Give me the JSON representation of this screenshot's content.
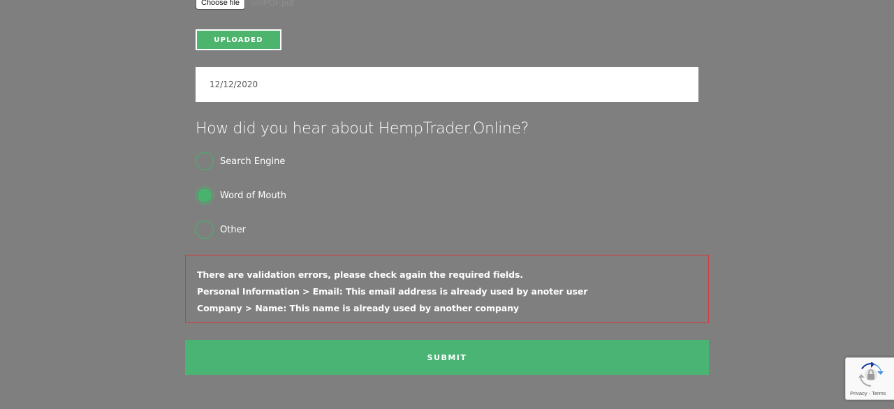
{
  "file_upload": {
    "choose_label": "Choose file",
    "file_name": "testPDF.pdf"
  },
  "uploaded_button": {
    "label": "UPLOADED"
  },
  "date_field": {
    "value": "12/12/2020"
  },
  "question": {
    "title": "How did you hear about HempTrader.Online?",
    "options": [
      {
        "label": "Search Engine",
        "selected": false
      },
      {
        "label": "Word of Mouth",
        "selected": true
      },
      {
        "label": "Other",
        "selected": false
      }
    ]
  },
  "errors": {
    "messages": [
      "There are validation errors, please check again the required fields.",
      "Personal Information > Email: This email address is already used by anoter user",
      "Company > Name: This name is already used by another company"
    ]
  },
  "submit_button": {
    "label": "SUBMIT"
  },
  "recaptcha": {
    "privacy": "Privacy",
    "separator": " - ",
    "terms": "Terms"
  },
  "colors": {
    "background": "#7f7f7f",
    "accent_green": "#49b474",
    "error_border": "#d43a3a"
  },
  "icons": [
    "recaptcha-logo-icon"
  ]
}
